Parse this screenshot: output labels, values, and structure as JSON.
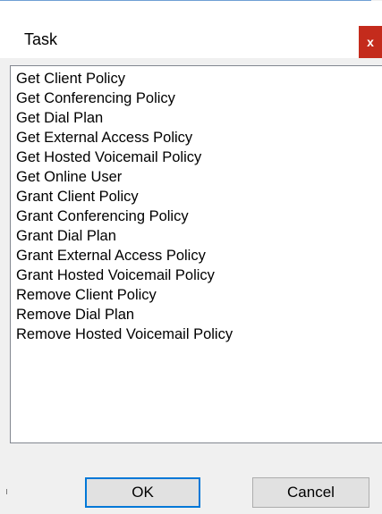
{
  "window": {
    "title": "Task",
    "close_label": "x"
  },
  "list": {
    "items": [
      "Get Client Policy",
      "Get Conferencing Policy",
      "Get Dial Plan",
      "Get External Access Policy",
      "Get Hosted Voicemail Policy",
      "Get Online User",
      "Grant Client Policy",
      "Grant Conferencing Policy",
      "Grant Dial Plan",
      "Grant External Access Policy",
      "Grant Hosted Voicemail Policy",
      "Remove Client Policy",
      "Remove Dial Plan",
      "Remove Hosted Voicemail Policy"
    ]
  },
  "buttons": {
    "ok_label": "OK",
    "cancel_label": "Cancel"
  },
  "colors": {
    "close_button": "#c42b1c",
    "default_button_border": "#0078d7",
    "list_border": "#828790",
    "window_border": "#6f9fd4"
  }
}
